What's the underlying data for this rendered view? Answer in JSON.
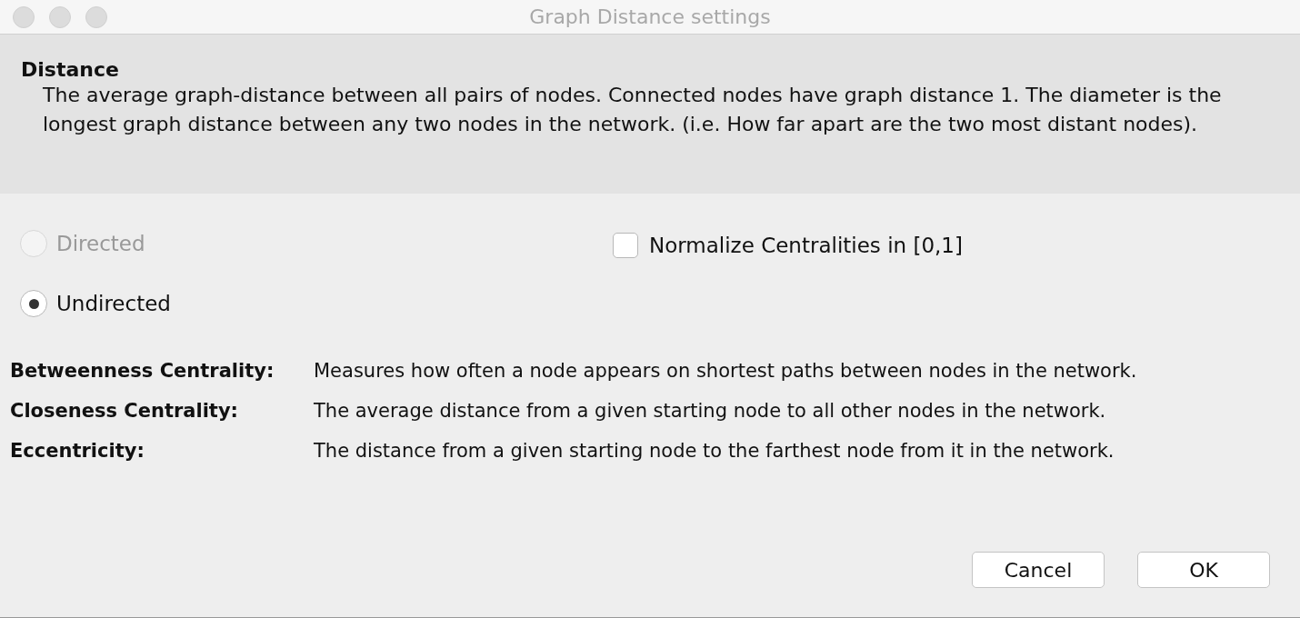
{
  "window": {
    "title": "Graph Distance settings"
  },
  "header": {
    "title": "Distance",
    "description": "The average graph-distance between all pairs of nodes. Connected nodes have graph distance 1. The diameter is the longest graph distance between any two nodes in the network. (i.e.  How far apart are the two most distant nodes)."
  },
  "graph_type": [
    {
      "label": "Directed",
      "selected": false,
      "disabled": true
    },
    {
      "label": "Undirected",
      "selected": true,
      "disabled": false
    }
  ],
  "normalize": {
    "label": "Normalize Centralities in [0,1]",
    "checked": false
  },
  "definitions": [
    {
      "term": "Betweenness Centrality:",
      "text": "Measures how often a node appears on shortest paths between nodes in the network."
    },
    {
      "term": "Closeness Centrality:",
      "text": "The average distance from a given starting node to all other nodes in the network."
    },
    {
      "term": "Eccentricity:",
      "text": "The distance from a given starting node to the farthest node from it in the network."
    }
  ],
  "buttons": [
    "Cancel",
    "OK"
  ]
}
